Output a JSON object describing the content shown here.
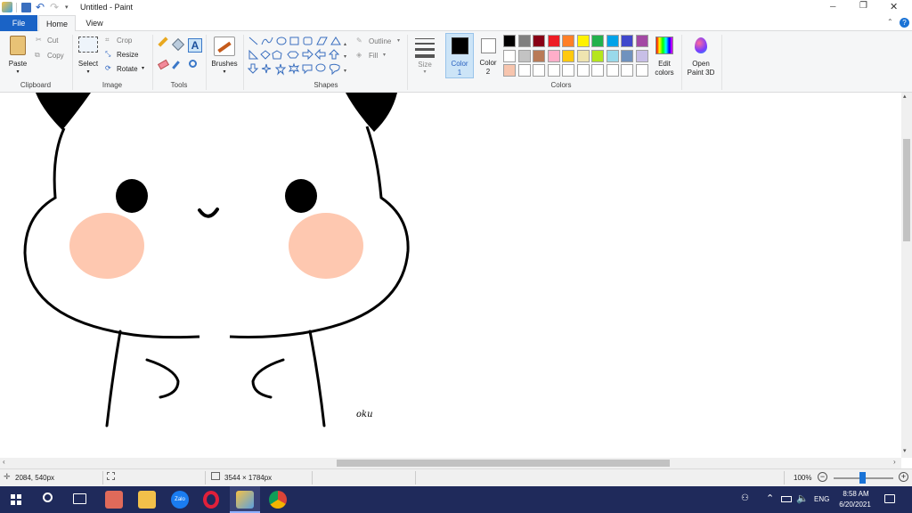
{
  "window": {
    "title": "Untitled - Paint",
    "min_glyph": "─",
    "restore_glyph": "❐",
    "close_glyph": "✕"
  },
  "tabs": {
    "file": "File",
    "home": "Home",
    "view": "View"
  },
  "ribbon": {
    "clipboard": {
      "paste": "Paste",
      "cut": "Cut",
      "copy": "Copy",
      "group": "Clipboard"
    },
    "image": {
      "select": "Select",
      "crop": "Crop",
      "resize": "Resize",
      "rotate": "Rotate",
      "group": "Image"
    },
    "tools": {
      "group": "Tools",
      "text_glyph": "A"
    },
    "brushes": {
      "label": "Brushes"
    },
    "shapes": {
      "outline": "Outline",
      "fill": "Fill",
      "group": "Shapes"
    },
    "size": {
      "label": "Size"
    },
    "color1": {
      "label1": "Color",
      "label2": "1"
    },
    "color2": {
      "label1": "Color",
      "label2": "2"
    },
    "colors": {
      "group": "Colors",
      "row1": [
        "#000000",
        "#7f7f7f",
        "#880015",
        "#ed1c24",
        "#ff7f27",
        "#fff200",
        "#22b14c",
        "#00a2e8",
        "#3f48cc",
        "#a349a4"
      ],
      "row2": [
        "#ffffff",
        "#c3c3c3",
        "#b97a57",
        "#ffaec9",
        "#ffc90e",
        "#efe4b0",
        "#b5e61d",
        "#99d9ea",
        "#7092be",
        "#c8bfe7"
      ],
      "row3": [
        "#f7c5ae",
        "#ffffff",
        "#ffffff",
        "#ffffff",
        "#ffffff",
        "#ffffff",
        "#ffffff",
        "#ffffff",
        "#ffffff",
        "#ffffff"
      ],
      "color1_value": "#000000",
      "color2_value": "#ffffff"
    },
    "edit_colors": {
      "line1": "Edit",
      "line2": "colors"
    },
    "paint3d": {
      "line1": "Open",
      "line2": "Paint 3D"
    }
  },
  "drawing": {
    "signature": "oku",
    "blush_color": "#fec8b0"
  },
  "status": {
    "cursor_pos": "2084, 540px",
    "canvas_size": "3544 × 1784px",
    "zoom": "100%"
  },
  "taskbar": {
    "zalo": "Zalo",
    "language": "ENG",
    "time": "8:58 AM",
    "date": "6/20/2021"
  }
}
